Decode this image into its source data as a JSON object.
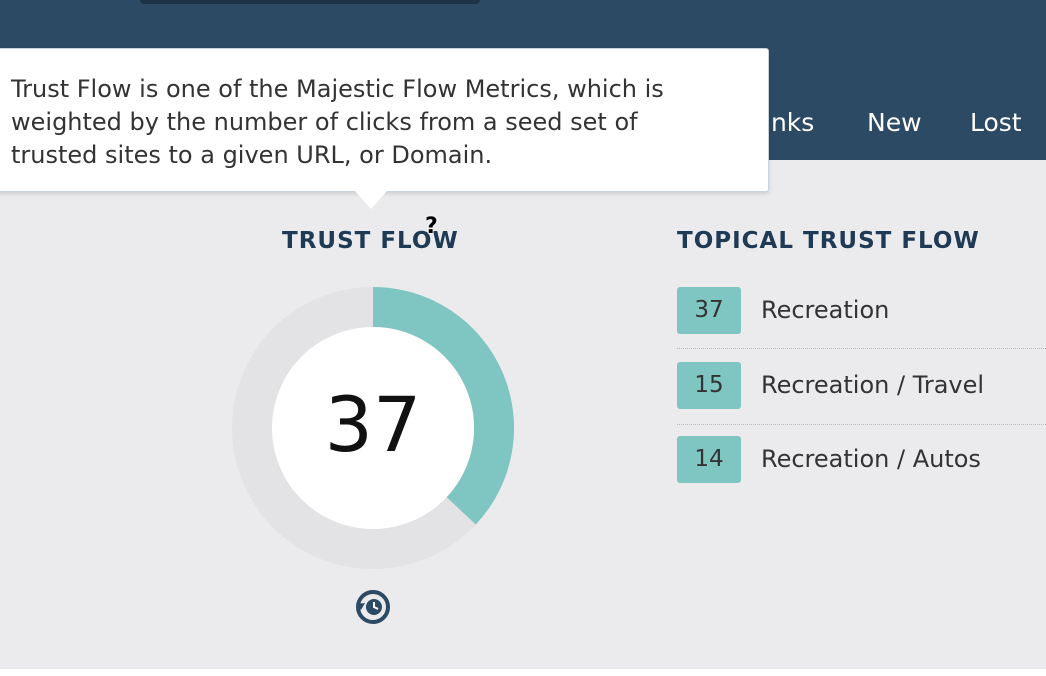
{
  "nav": {
    "tabs": [
      {
        "label": "inks"
      },
      {
        "label": "New"
      },
      {
        "label": "Lost"
      }
    ]
  },
  "tooltip": {
    "lines": [
      "Trust Flow is one of the Majestic Flow Metrics, which is",
      "weighted by the number of clicks from a seed set of",
      "trusted sites to a given URL, or Domain."
    ]
  },
  "trust_flow": {
    "title": "TRUST FLOW",
    "value": "37",
    "gauge_fraction": 0.37,
    "gauge_color": "#7fc5c2",
    "track_color": "#e3e3e5"
  },
  "topical_trust_flow": {
    "title": "TOPICAL TRUST FLOW",
    "items": [
      {
        "score": "37",
        "label": "Recreation"
      },
      {
        "score": "15",
        "label": "Recreation / Travel"
      },
      {
        "score": "14",
        "label": "Recreation / Autos"
      }
    ]
  },
  "colors": {
    "header": "#2c4a64",
    "content_bg": "#ebebed",
    "badge": "#7fc5c2",
    "title": "#1f3a54"
  },
  "icons": {
    "help": "question-mark-cursor",
    "history": "history-clock-icon"
  }
}
